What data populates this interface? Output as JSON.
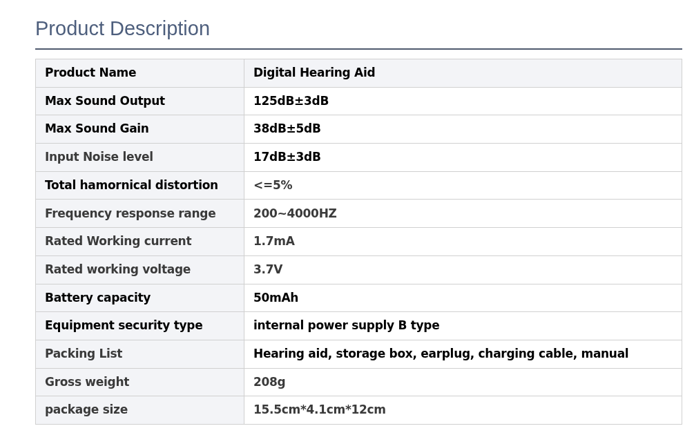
{
  "heading": "Product Description",
  "rows": [
    {
      "kind": "header",
      "label": "Product Name",
      "value": "Digital Hearing Aid",
      "label_dark": true,
      "value_dark": true
    },
    {
      "kind": "body",
      "label": "Max Sound Output",
      "value": "125dB±3dB",
      "label_dark": true,
      "value_dark": true
    },
    {
      "kind": "body",
      "label": "Max Sound Gain",
      "value": "38dB±5dB",
      "label_dark": true,
      "value_dark": true
    },
    {
      "kind": "body",
      "label": "Input Noise level",
      "value": "17dB±3dB",
      "label_dark": false,
      "value_dark": true
    },
    {
      "kind": "body",
      "label": "Total hamornical distortion",
      "value": "<=5%",
      "label_dark": true,
      "value_dark": false
    },
    {
      "kind": "body",
      "label": "Frequency response range",
      "value": "200~4000HZ",
      "label_dark": false,
      "value_dark": false
    },
    {
      "kind": "body",
      "label": "Rated Working current",
      "value": "1.7mA",
      "label_dark": false,
      "value_dark": false
    },
    {
      "kind": "body",
      "label": "Rated working voltage",
      "value": "3.7V",
      "label_dark": false,
      "value_dark": false
    },
    {
      "kind": "body",
      "label": "Battery capacity",
      "value": "50mAh",
      "label_dark": true,
      "value_dark": true
    },
    {
      "kind": "body",
      "label": "Equipment security type",
      "value": "internal power supply B type",
      "label_dark": true,
      "value_dark": true
    },
    {
      "kind": "body",
      "label": "Packing List",
      "value": "Hearing aid, storage box, earplug, charging cable, manual",
      "label_dark": false,
      "value_dark": true
    },
    {
      "kind": "body",
      "label": "Gross weight",
      "value": "208g",
      "label_dark": false,
      "value_dark": false
    },
    {
      "kind": "body",
      "label": "package size",
      "value": "15.5cm*4.1cm*12cm",
      "label_dark": false,
      "value_dark": false
    }
  ]
}
